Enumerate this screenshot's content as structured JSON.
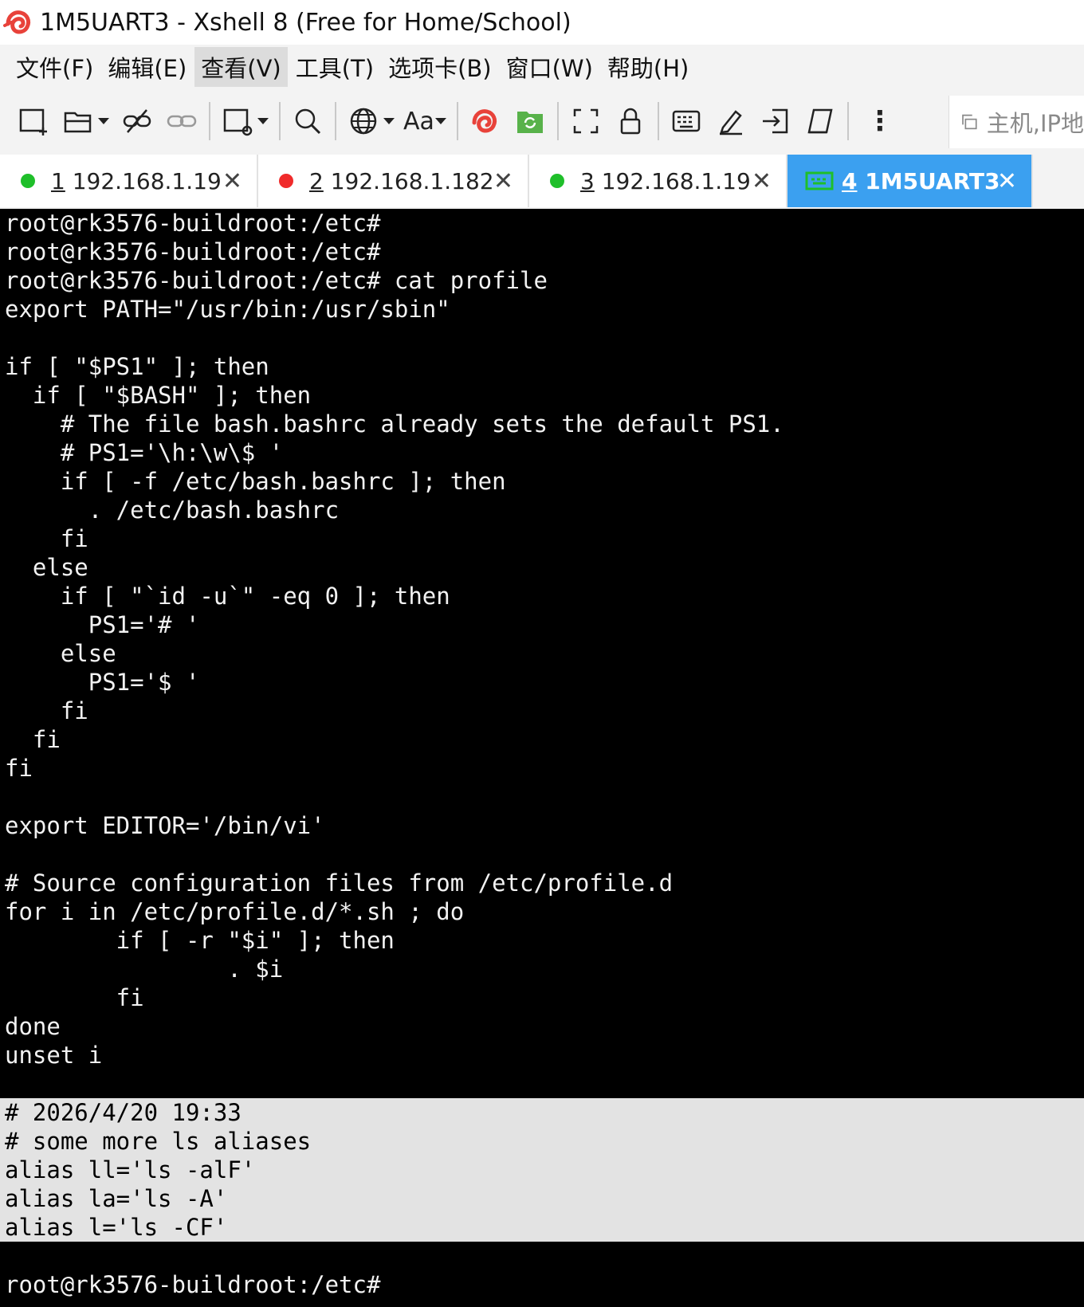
{
  "window": {
    "title": "1M5UART3 - Xshell 8 (Free for Home/School)"
  },
  "menu": [
    {
      "label": "文件(F)"
    },
    {
      "label": "编辑(E)"
    },
    {
      "label": "查看(V)"
    },
    {
      "label": "工具(T)"
    },
    {
      "label": "选项卡(B)"
    },
    {
      "label": "窗口(W)"
    },
    {
      "label": "帮助(H)"
    }
  ],
  "toolbar": {
    "font_label": "Aa",
    "more_label": "⋮",
    "host_placeholder": "主机,IP地"
  },
  "tabs": [
    {
      "num": "1",
      "label": " 192.168.1.19",
      "status_color": "#1fbf2a",
      "close": "✕"
    },
    {
      "num": "2",
      "label": " 192.168.1.182",
      "status_color": "#f02b2b",
      "close": "✕"
    },
    {
      "num": "3",
      "label": " 192.168.1.19",
      "status_color": "#1fbf2a",
      "close": "✕"
    },
    {
      "num": "4",
      "label": " 1M5UART3",
      "close": "✕"
    }
  ],
  "terminal": {
    "lines": [
      "root@rk3576-buildroot:/etc#",
      "root@rk3576-buildroot:/etc#",
      "root@rk3576-buildroot:/etc# cat profile",
      "export PATH=\"/usr/bin:/usr/sbin\"",
      "",
      "if [ \"$PS1\" ]; then",
      "  if [ \"$BASH\" ]; then",
      "    # The file bash.bashrc already sets the default PS1.",
      "    # PS1='\\h:\\w\\$ '",
      "    if [ -f /etc/bash.bashrc ]; then",
      "      . /etc/bash.bashrc",
      "    fi",
      "  else",
      "    if [ \"`id -u`\" -eq 0 ]; then",
      "      PS1='# '",
      "    else",
      "      PS1='$ '",
      "    fi",
      "  fi",
      "fi",
      "",
      "export EDITOR='/bin/vi'",
      "",
      "# Source configuration files from /etc/profile.d",
      "for i in /etc/profile.d/*.sh ; do",
      "        if [ -r \"$i\" ]; then",
      "                . $i",
      "        fi",
      "done",
      "unset i",
      "",
      "# 2026/4/20 19:33",
      "# some more ls aliases",
      "alias ll='ls -alF'",
      "alias la='ls -A'",
      "alias l='ls -CF'",
      "",
      "root@rk3576-buildroot:/etc#"
    ]
  }
}
